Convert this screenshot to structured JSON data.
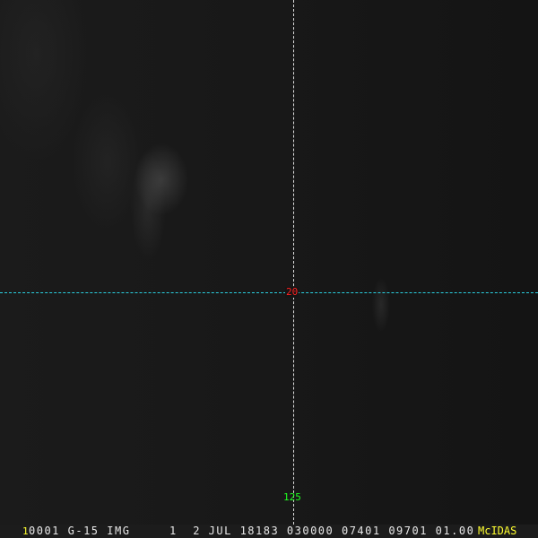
{
  "overlay": {
    "latitude_label": "20",
    "longitude_label": "125"
  },
  "status_bar": {
    "frame_number": "1",
    "info": "0001 G-15 IMG     1  2 JUL 18183 030000 07401 09701 01.00",
    "logo": "McIDAS"
  },
  "colors": {
    "latitude_line": "#2ad0e0",
    "longitude_line": "#dddddd",
    "latitude_label": "#ff2020",
    "longitude_label": "#20ff20",
    "logo": "#ffff30"
  }
}
